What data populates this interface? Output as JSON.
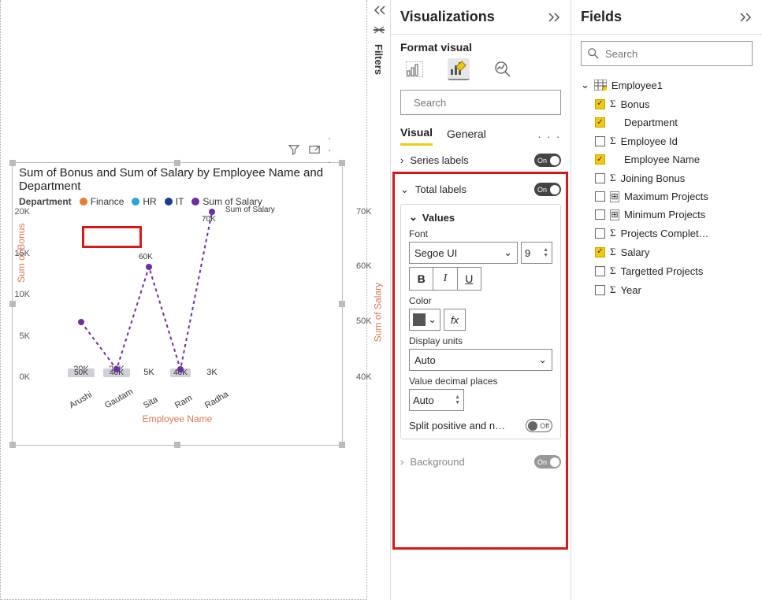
{
  "panes": {
    "filters": "Filters",
    "visualizations_title": "Visualizations",
    "format_visual": "Format visual",
    "fields_title": "Fields"
  },
  "search": {
    "placeholder": "Search"
  },
  "tabs": {
    "visual": "Visual",
    "general": "General"
  },
  "sections": {
    "series_labels": {
      "label": "Series labels",
      "state": "On"
    },
    "total_labels": {
      "label": "Total labels",
      "state": "On"
    },
    "background": {
      "label": "Background",
      "state": "On"
    }
  },
  "values_card": {
    "title": "Values",
    "font_label": "Font",
    "font_family": "Segoe UI",
    "font_size": "9",
    "bold": "B",
    "italic": "I",
    "underline": "U",
    "color_label": "Color",
    "fx_label": "fx",
    "display_units_label": "Display units",
    "display_units_value": "Auto",
    "decimal_label": "Value decimal places",
    "decimal_value": "Auto",
    "split_label": "Split positive and n…",
    "split_state": "Off"
  },
  "fields": {
    "table": "Employee1",
    "items": [
      {
        "label": "Bonus",
        "checked": true,
        "icon": "sigma"
      },
      {
        "label": "Department",
        "checked": true,
        "icon": "none"
      },
      {
        "label": "Employee Id",
        "checked": false,
        "icon": "sigma"
      },
      {
        "label": "Employee Name",
        "checked": true,
        "icon": "none"
      },
      {
        "label": "Joining Bonus",
        "checked": false,
        "icon": "sigma"
      },
      {
        "label": "Maximum Projects",
        "checked": false,
        "icon": "calc"
      },
      {
        "label": "Minimum Projects",
        "checked": false,
        "icon": "calc"
      },
      {
        "label": "Projects Complet…",
        "checked": false,
        "icon": "sigma"
      },
      {
        "label": "Salary",
        "checked": true,
        "icon": "sigma"
      },
      {
        "label": "Targetted Projects",
        "checked": false,
        "icon": "sigma"
      },
      {
        "label": "Year",
        "checked": false,
        "icon": "sigma"
      }
    ]
  },
  "chart": {
    "title": "Sum of Bonus and Sum of Salary by Employee Name and Department",
    "legend_label": "Department",
    "legend": [
      {
        "label": "Finance",
        "color": "#e57f30"
      },
      {
        "label": "HR",
        "color": "#2ea2d8"
      },
      {
        "label": "IT",
        "color": "#1f3b8c"
      },
      {
        "label": "Sum of Salary",
        "color": "#6b2fa0"
      }
    ],
    "y1_label": "Sum of Bonus",
    "y2_label": "Sum of Salary",
    "x_label": "Employee Name",
    "line_series_label": "Sum of Salary",
    "y1_ticks": [
      "0K",
      "5K",
      "10K",
      "15K",
      "20K"
    ],
    "y2_ticks": [
      "40K",
      "50K",
      "60K",
      "70K"
    ],
    "totals": [
      "20K",
      "20K",
      "5K",
      "4K",
      "3K"
    ],
    "seg_labels": [
      "50K",
      "40K",
      "40K"
    ],
    "line_labels": [
      "60K",
      "70K"
    ],
    "x_names": [
      "Arushi",
      "Gautam",
      "Sita",
      "Ram",
      "Radha"
    ]
  },
  "chart_data": {
    "type": "bar",
    "categories": [
      "Arushi",
      "Gautam",
      "Sita",
      "Ram",
      "Radha"
    ],
    "series": [
      {
        "name": "IT",
        "color": "#1f3b8c",
        "values": [
          20000,
          20000,
          0,
          4000,
          0
        ]
      },
      {
        "name": "Finance",
        "color": "#e57f30",
        "values": [
          0,
          0,
          5000,
          0,
          0
        ]
      },
      {
        "name": "HR",
        "color": "#2ea2d8",
        "values": [
          0,
          0,
          0,
          0,
          3000
        ]
      }
    ],
    "line_series": {
      "name": "Sum of Salary",
      "color": "#6b2fa0",
      "values": [
        50000,
        40000,
        60000,
        40000,
        70000
      ]
    },
    "title": "Sum of Bonus and Sum of Salary by Employee Name and Department",
    "xlabel": "Employee Name",
    "ylabel": "Sum of Bonus",
    "y2label": "Sum of Salary",
    "ylim": [
      0,
      20000
    ],
    "y2lim": [
      40000,
      70000
    ]
  }
}
